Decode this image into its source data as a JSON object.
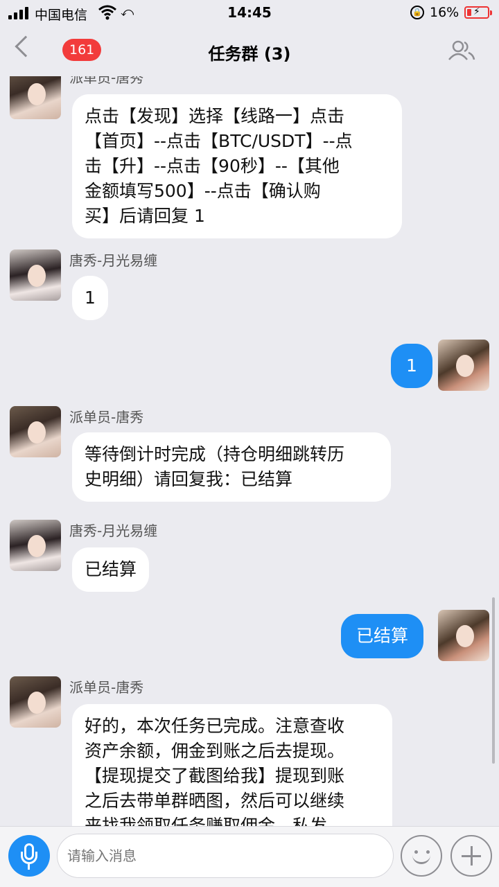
{
  "status_bar": {
    "carrier": "中国电信",
    "time": "14:45",
    "battery_percent": "16%",
    "icons": [
      "signal-icon",
      "wifi-icon",
      "link-icon",
      "orientation-lock-icon",
      "battery-charging-icon"
    ]
  },
  "nav": {
    "back_badge": "161",
    "title": "任务群 (3)",
    "icons": [
      "back-chevron-icon",
      "members-icon"
    ]
  },
  "messages": [
    {
      "sender": "派单员-唐秀",
      "from_me": false,
      "text": "点击【发现】选择【线路一】点击【首页】--点击【BTC/USDT】--点击【升】--点击【90秒】--【其他金额填写500】--点击【确认购买】后请回复1",
      "lines": [
        "点击【发现】选择【线路一】点击",
        "【首页】--点击【BTC/USDT】--点",
        "击【升】--点击【90秒】--【其他",
        "金额填写500】--点击【确认购",
        "买】后请回复 1"
      ]
    },
    {
      "sender": "唐秀-月光易缠",
      "from_me": false,
      "text": "1"
    },
    {
      "sender": "",
      "from_me": true,
      "text": "1"
    },
    {
      "sender": "派单员-唐秀",
      "from_me": false,
      "text": "等待倒计时完成（持仓明细跳转历史明细）请回复我：已结算",
      "lines": [
        "等待倒计时完成（持仓明细跳转历",
        "史明细）请回复我：已结算"
      ]
    },
    {
      "sender": "唐秀-月光易缠",
      "from_me": false,
      "text": "已结算"
    },
    {
      "sender": "",
      "from_me": true,
      "text": "已结算"
    },
    {
      "sender": "派单员-唐秀",
      "from_me": false,
      "text": "好的，本次任务已完成。注意查收资产余额，佣金到账之后去提现。【提现提交了截图给我】提现到账之后去带单群晒图，然后可以继续来找我领取任务赚取佣金。私发",
      "lines": [
        "好的，本次任务已完成。注意查收",
        "资产余额，佣金到账之后去提现。",
        "【提现提交了截图给我】提现到账",
        "之后去带单群晒图，然后可以继续",
        "来找我领取任务赚取佣金。私发"
      ]
    }
  ],
  "input_bar": {
    "placeholder": "请输入消息",
    "icons": [
      "microphone-icon",
      "emoji-icon",
      "plus-icon"
    ]
  },
  "colors": {
    "background": "#ebebf0",
    "my_bubble": "#1e8ff5",
    "their_bubble": "#ffffff",
    "badge": "#f23b3b"
  }
}
